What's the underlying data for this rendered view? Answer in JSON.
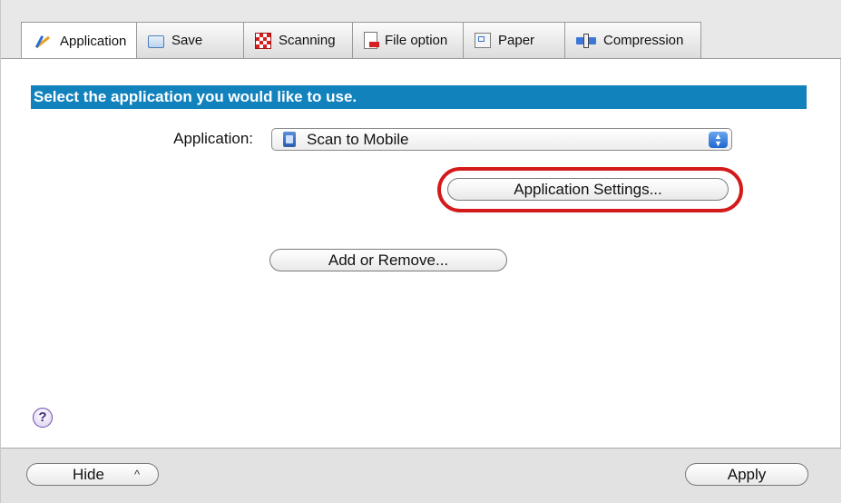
{
  "tabs": [
    {
      "label": "Application",
      "icon": "application-icon",
      "active": true
    },
    {
      "label": "Save",
      "icon": "folder-icon"
    },
    {
      "label": "Scanning",
      "icon": "scanning-icon"
    },
    {
      "label": "File option",
      "icon": "file-option-icon"
    },
    {
      "label": "Paper",
      "icon": "paper-icon"
    },
    {
      "label": "Compression",
      "icon": "compression-icon"
    }
  ],
  "main": {
    "banner": "Select the application you would like to use.",
    "application_label": "Application:",
    "application_value": "Scan to Mobile",
    "application_settings_button": "Application Settings...",
    "add_remove_button": "Add or Remove...",
    "help_glyph": "?"
  },
  "footer": {
    "hide_button": "Hide",
    "hide_chevron": "^",
    "apply_button": "Apply"
  },
  "colors": {
    "banner_bg": "#1282bd",
    "highlight": "#d41a1a"
  }
}
